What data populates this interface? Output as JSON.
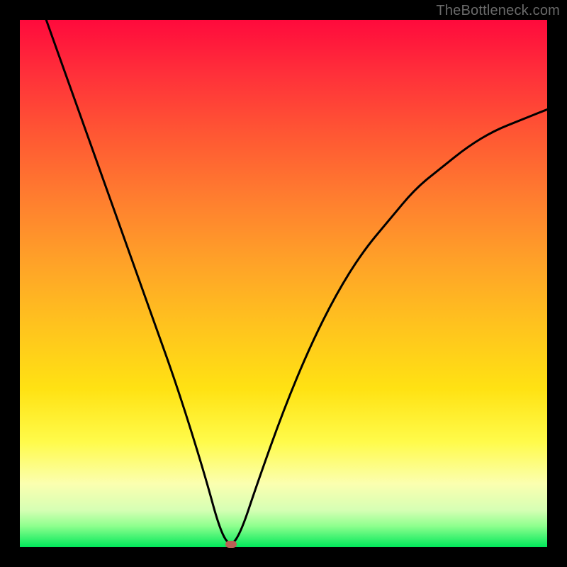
{
  "watermark": "TheBottleneck.com",
  "colors": {
    "frame": "#000000",
    "curve": "#000000",
    "dot": "#bb5f55",
    "gradient_top": "#ff0a3c",
    "gradient_bottom": "#00e85a"
  },
  "chart_data": {
    "type": "line",
    "title": "",
    "xlabel": "",
    "ylabel": "",
    "xlim": [
      0,
      100
    ],
    "ylim": [
      0,
      100
    ],
    "grid": false,
    "legend": false,
    "annotations": [
      "TheBottleneck.com"
    ],
    "series": [
      {
        "name": "bottleneck-curve",
        "x": [
          5,
          10,
          15,
          20,
          25,
          30,
          35,
          38,
          40,
          42,
          45,
          50,
          55,
          60,
          65,
          70,
          75,
          80,
          85,
          90,
          95,
          100
        ],
        "y": [
          100,
          86,
          72,
          58,
          44,
          30,
          14,
          3,
          0,
          3,
          12,
          26,
          38,
          48,
          56,
          62,
          68,
          72,
          76,
          79,
          81,
          83
        ]
      }
    ],
    "minimum_point": {
      "x": 40,
      "y": 0
    },
    "description": "V-shaped curve over a vertical red-to-green gradient. Minimum (optimal) point near x≈40 at y=0; curve rises steeply to the left toward y=100 at x≈5 and rises with decreasing slope to the right toward y≈83 at x=100."
  }
}
